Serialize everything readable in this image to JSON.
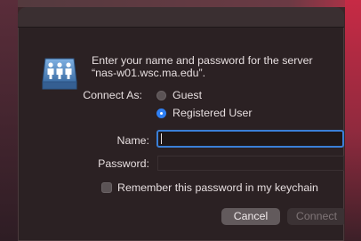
{
  "dialog": {
    "message": "Enter your name and password for the server “nas-w01.wsc.ma.edu”.",
    "connect_as_label": "Connect As:",
    "connect_as_options": [
      {
        "label": "Guest",
        "selected": false
      },
      {
        "label": "Registered User",
        "selected": true
      }
    ],
    "name_label": "Name:",
    "name_value": "",
    "password_label": "Password:",
    "password_value": "",
    "remember_label": "Remember this password in my keychain",
    "remember_checked": false,
    "cancel_label": "Cancel",
    "connect_label": "Connect",
    "icon": "server-share-icon"
  },
  "colors": {
    "accent": "#2f7ff2",
    "dialog_bg": "#2b2123",
    "text": "#e6dedf"
  }
}
